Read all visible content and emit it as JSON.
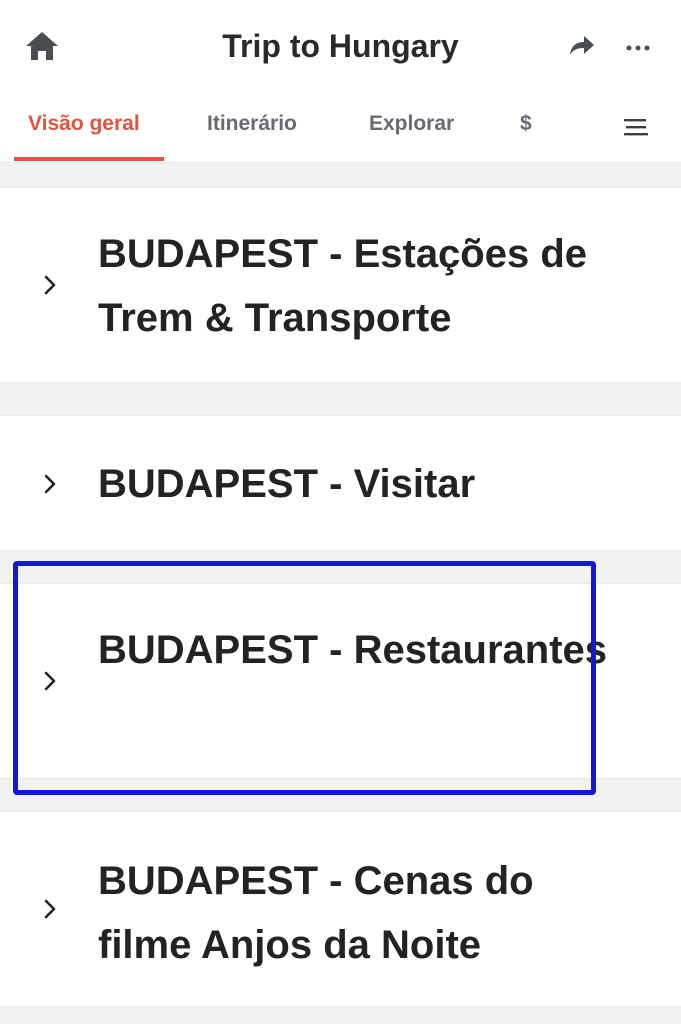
{
  "header": {
    "title": "Trip to Hungary",
    "icons": {
      "home": "home-icon",
      "share": "share-icon",
      "more": "more-icon",
      "menu": "menu-icon"
    }
  },
  "tabs": [
    {
      "label": "Visão geral",
      "active": true
    },
    {
      "label": "Itinerário",
      "active": false
    },
    {
      "label": "Explorar",
      "active": false
    },
    {
      "label": "$",
      "active": false
    }
  ],
  "sections": [
    {
      "title": "BUDAPEST - Estações de Trem & Transporte",
      "expanded": false
    },
    {
      "title": "BUDAPEST - Visitar",
      "expanded": false
    },
    {
      "title": "BUDAPEST - Restaurantes",
      "expanded": false,
      "highlighted": true
    },
    {
      "title": "BUDAPEST - Cenas do filme Anjos da Noite",
      "expanded": false
    }
  ],
  "colors": {
    "accent": "#e0553f",
    "highlight": "#1515e0",
    "background": "#f1f2f4",
    "icon": "#4a4d52"
  }
}
